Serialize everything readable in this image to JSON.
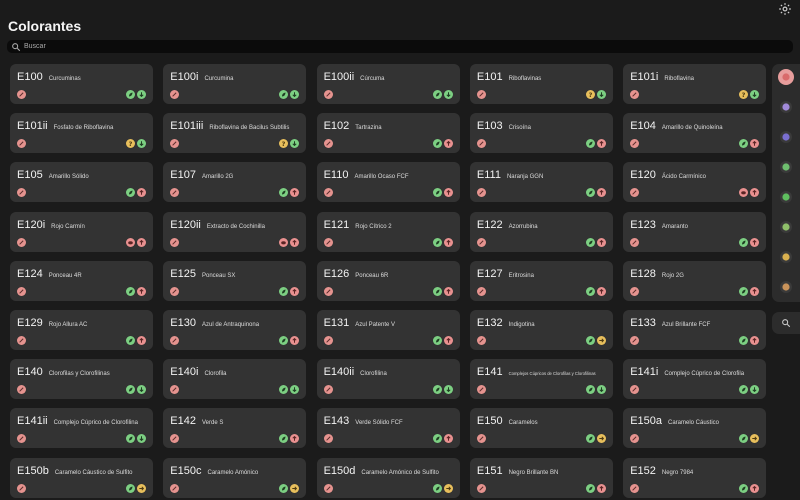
{
  "header": {
    "title": "Colorantes"
  },
  "search": {
    "placeholder": "Buscar"
  },
  "colors": {
    "background": "#1b1b1b",
    "card": "#333333",
    "vegan": "#7ccf82",
    "down": "#7ccf82",
    "up": "#e99190",
    "right": "#e8bf5c",
    "question": "#e8bf5c",
    "nonveg": "#e99190",
    "diet": "#e5938f"
  },
  "items": [
    {
      "code": "E100",
      "name": "Curcuminas",
      "badges": [
        "vegan",
        "down"
      ]
    },
    {
      "code": "E100i",
      "name": "Curcumina",
      "badges": [
        "vegan",
        "down"
      ]
    },
    {
      "code": "E100ii",
      "name": "Cúrcuma",
      "badges": [
        "vegan",
        "down"
      ]
    },
    {
      "code": "E101",
      "name": "Riboflavinas",
      "badges": [
        "question",
        "down"
      ]
    },
    {
      "code": "E101i",
      "name": "Riboflavina",
      "badges": [
        "question",
        "down"
      ]
    },
    {
      "code": "E101ii",
      "name": "Fosfato de Riboflavina",
      "badges": [
        "question",
        "down"
      ]
    },
    {
      "code": "E101iii",
      "name": "Riboflavina de Bacilus Subtilis",
      "badges": [
        "question",
        "down"
      ]
    },
    {
      "code": "E102",
      "name": "Tartrazina",
      "badges": [
        "vegan",
        "up"
      ]
    },
    {
      "code": "E103",
      "name": "Crisoína",
      "badges": [
        "vegan",
        "up"
      ]
    },
    {
      "code": "E104",
      "name": "Amarillo de Quinoleína",
      "badges": [
        "vegan",
        "up"
      ]
    },
    {
      "code": "E105",
      "name": "Amarillo Sólido",
      "badges": [
        "vegan",
        "up"
      ]
    },
    {
      "code": "E107",
      "name": "Amarillo 2G",
      "badges": [
        "vegan",
        "up"
      ]
    },
    {
      "code": "E110",
      "name": "Amarillo Ocaso FCF",
      "badges": [
        "vegan",
        "up"
      ]
    },
    {
      "code": "E111",
      "name": "Naranja GGN",
      "badges": [
        "vegan",
        "up"
      ]
    },
    {
      "code": "E120",
      "name": "Ácido Carmínico",
      "badges": [
        "nonveg",
        "up"
      ]
    },
    {
      "code": "E120i",
      "name": "Rojo Carmín",
      "badges": [
        "nonveg",
        "up"
      ]
    },
    {
      "code": "E120ii",
      "name": "Extracto de Cochinilla",
      "badges": [
        "nonveg",
        "up"
      ]
    },
    {
      "code": "E121",
      "name": "Rojo Cítrico 2",
      "badges": [
        "vegan",
        "up"
      ]
    },
    {
      "code": "E122",
      "name": "Azorrubina",
      "badges": [
        "vegan",
        "up"
      ]
    },
    {
      "code": "E123",
      "name": "Amaranto",
      "badges": [
        "vegan",
        "up"
      ]
    },
    {
      "code": "E124",
      "name": "Ponceau 4R",
      "badges": [
        "vegan",
        "up"
      ]
    },
    {
      "code": "E125",
      "name": "Ponceau SX",
      "badges": [
        "vegan",
        "up"
      ]
    },
    {
      "code": "E126",
      "name": "Ponceau 6R",
      "badges": [
        "vegan",
        "up"
      ]
    },
    {
      "code": "E127",
      "name": "Eritrosina",
      "badges": [
        "vegan",
        "up"
      ]
    },
    {
      "code": "E128",
      "name": "Rojo 2G",
      "badges": [
        "vegan",
        "up"
      ]
    },
    {
      "code": "E129",
      "name": "Rojo Allura AC",
      "badges": [
        "vegan",
        "up"
      ]
    },
    {
      "code": "E130",
      "name": "Azul de Antraquinona",
      "badges": [
        "vegan",
        "up"
      ]
    },
    {
      "code": "E131",
      "name": "Azul Patente V",
      "badges": [
        "vegan",
        "up"
      ]
    },
    {
      "code": "E132",
      "name": "Indigotina",
      "badges": [
        "vegan",
        "right"
      ]
    },
    {
      "code": "E133",
      "name": "Azul Brillante FCF",
      "badges": [
        "vegan",
        "up"
      ]
    },
    {
      "code": "E140",
      "name": "Clorofilas y Clorofilinas",
      "badges": [
        "vegan",
        "down"
      ]
    },
    {
      "code": "E140i",
      "name": "Clorofila",
      "badges": [
        "vegan",
        "down"
      ]
    },
    {
      "code": "E140ii",
      "name": "Clorofilina",
      "badges": [
        "vegan",
        "down"
      ]
    },
    {
      "code": "E141",
      "name": "Complejos Cúpricos de Clorofilas y Clorofilinas",
      "badges": [
        "vegan",
        "down"
      ],
      "small": true
    },
    {
      "code": "E141i",
      "name": "Complejo Cúprico de Clorofila",
      "badges": [
        "vegan",
        "down"
      ]
    },
    {
      "code": "E141ii",
      "name": "Complejo Cúprico de Clorofilina",
      "badges": [
        "vegan",
        "down"
      ]
    },
    {
      "code": "E142",
      "name": "Verde S",
      "badges": [
        "vegan",
        "up"
      ]
    },
    {
      "code": "E143",
      "name": "Verde Sólido FCF",
      "badges": [
        "vegan",
        "up"
      ]
    },
    {
      "code": "E150",
      "name": "Caramelos",
      "badges": [
        "vegan",
        "right"
      ]
    },
    {
      "code": "E150a",
      "name": "Caramelo Cáustico",
      "badges": [
        "vegan",
        "right"
      ]
    },
    {
      "code": "E150b",
      "name": "Caramelo Cáustico de Sulfito",
      "badges": [
        "vegan",
        "right"
      ]
    },
    {
      "code": "E150c",
      "name": "Caramelo Amónico",
      "badges": [
        "vegan",
        "right"
      ]
    },
    {
      "code": "E150d",
      "name": "Caramelo Amónico de Sulfito",
      "badges": [
        "vegan",
        "right"
      ]
    },
    {
      "code": "E151",
      "name": "Negro Brillante BN",
      "badges": [
        "vegan",
        "up"
      ]
    },
    {
      "code": "E152",
      "name": "Negro 7984",
      "badges": [
        "vegan",
        "up"
      ]
    }
  ],
  "sidebar": {
    "categories": [
      {
        "icon": "colorants-icon",
        "color": "#d96b6b",
        "active": true
      },
      {
        "icon": "preservatives-icon",
        "color": "#a18ad9"
      },
      {
        "icon": "antioxidants-icon",
        "color": "#7a6fd0"
      },
      {
        "icon": "thickeners-icon",
        "color": "#6fbf6f"
      },
      {
        "icon": "emulsifiers-icon",
        "color": "#5fbf5f"
      },
      {
        "icon": "acidity-regulators-icon",
        "color": "#8fc06a"
      },
      {
        "icon": "warning-icon",
        "color": "#d9b04f"
      },
      {
        "icon": "misc-icon",
        "color": "#c9935a"
      }
    ],
    "search_icon": "search-icon"
  }
}
